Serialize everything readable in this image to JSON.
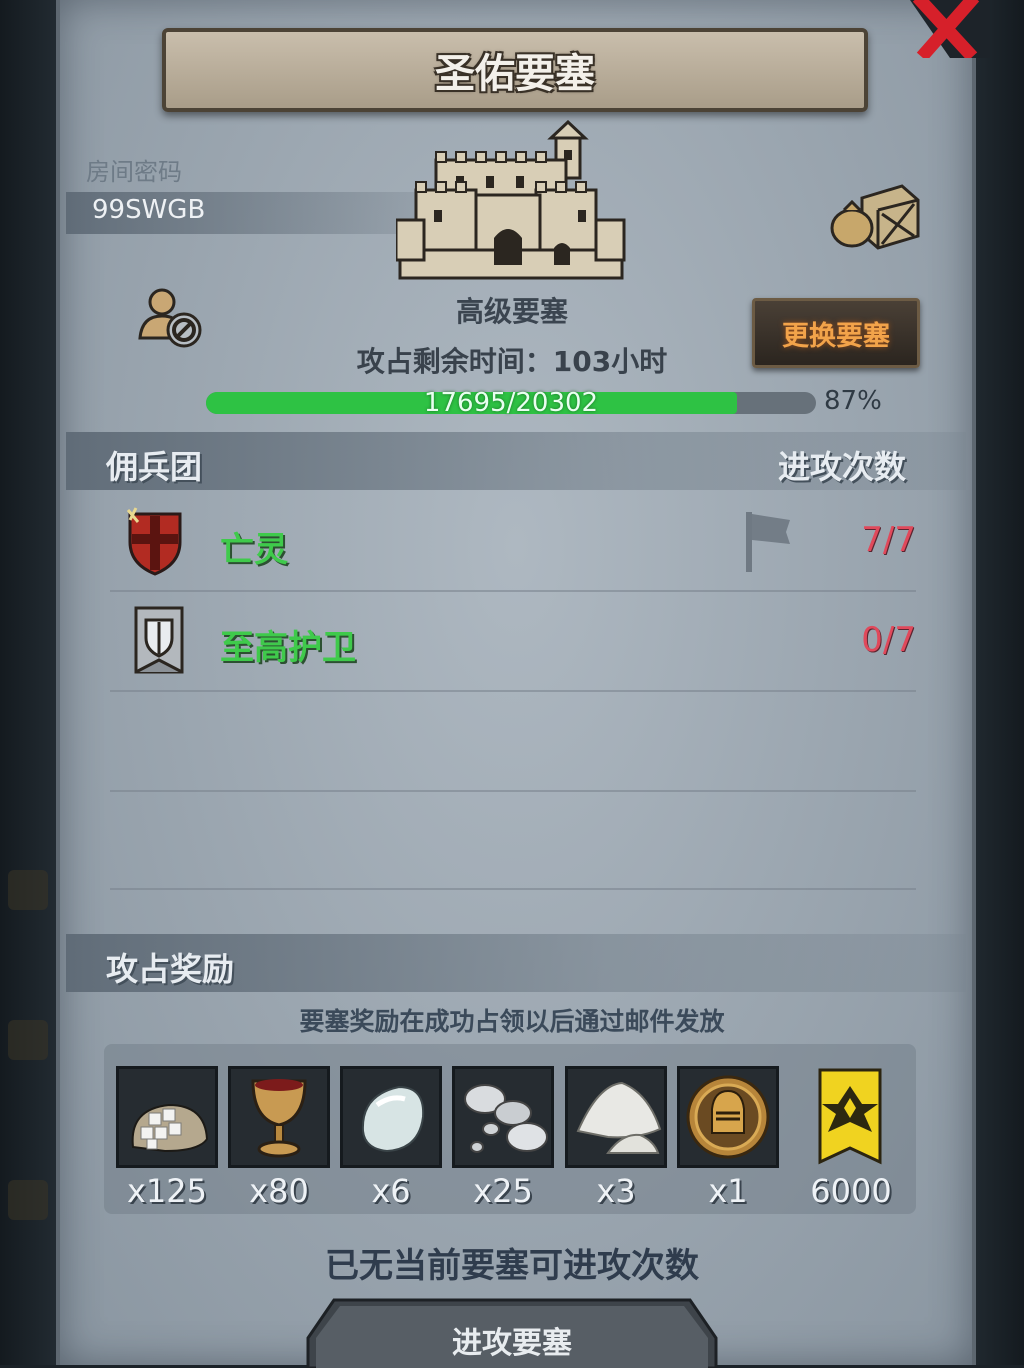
{
  "fortress": {
    "title": "圣佑要塞",
    "level_label": "高级要塞",
    "change_button": "更换要塞",
    "time_remaining": "攻占剩余时间：103小时"
  },
  "room": {
    "label": "房间密码",
    "code": "99SWGB"
  },
  "progress": {
    "text": "17695/20302",
    "percent_label": "87%",
    "fraction": 0.87
  },
  "mercenaries": {
    "header": "佣兵团",
    "attack_count_header": "进攻次数",
    "rows": [
      {
        "name": "亡灵",
        "count": "7/7",
        "icon": "red-cross-shield-icon",
        "flag_icon": "flag-icon"
      },
      {
        "name": "至高护卫",
        "count": "0/7",
        "icon": "silver-shield-banner-icon"
      }
    ]
  },
  "rewards": {
    "header": "攻占奖励",
    "note": "要塞奖励在成功占领以后通过邮件发放",
    "items": [
      {
        "icon": "sugar-sack-icon",
        "qty": "x125"
      },
      {
        "icon": "goblet-icon",
        "qty": "x80"
      },
      {
        "icon": "moonstone-icon",
        "qty": "x6"
      },
      {
        "icon": "silver-pearls-icon",
        "qty": "x25"
      },
      {
        "icon": "salt-pile-icon",
        "qty": "x3"
      },
      {
        "icon": "knight-medal-icon",
        "qty": "x1"
      },
      {
        "icon": "gold-banner-icon",
        "qty": "6000"
      }
    ]
  },
  "status": {
    "no_attack_text": "已无当前要塞可进攻次数",
    "attack_button": "进攻要塞"
  },
  "colors": {
    "progress_fill": "#2ec244",
    "mercenary_name": "#3fca4b",
    "attack_count": "#e0495b",
    "change_button_text": "#f2a34a"
  }
}
